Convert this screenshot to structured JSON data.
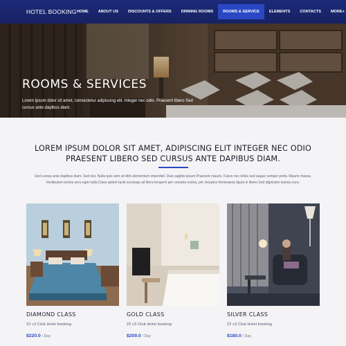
{
  "nav": {
    "brand": "HOTEL BOOKING",
    "items": [
      {
        "label": "HOME"
      },
      {
        "label": "ABOUT US"
      },
      {
        "label": "DISCOUNTS & OFFERS"
      },
      {
        "label": "DINNING ROOMS"
      },
      {
        "label": "ROOMS & SERVICE",
        "active": true
      },
      {
        "label": "ELEMENTS"
      },
      {
        "label": "CONTACTS"
      },
      {
        "label": "MORE+"
      }
    ]
  },
  "hero": {
    "title": "ROOMS & SERVICES",
    "subtitle": "Lorem ipsum dolor sit amet, consectetur adipiscing elit. Integer nec odio. Praesent libero Sed cursus ante dapibus diam."
  },
  "intro": {
    "title": "LOREM IPSUM DOLOR SIT AMET, ADIPISCING ELIT INTEGER NEC ODIO PRAESENT LIBERO SED CURSUS ANTE DAPIBUS DIAM.",
    "text": "Sed cursus ante dapibus diam. Sed nisi. Nulla quis sem at nibh elementum imperdiet. Duis sagittis ipsum.Praesent mauris. Fusce nec tellus sed augue semper porta. Mauris massa. Vestibulum lacinia arcu eget nulla.Class aptent taciti sociosqu ad litora torquent per conubia nostra, per inceptos himenaeos ligula in libero.Sed dignissim lacinia nunc."
  },
  "rooms": [
    {
      "name": "DIAMOND CLASS",
      "subtitle": "22 c3 Club Hotel booking",
      "price": "$220.0",
      "per": "/ Day"
    },
    {
      "name": "GOLD CLASS",
      "subtitle": "22 c3 Club Hotel booking",
      "price": "$200.0",
      "per": "/ Day"
    },
    {
      "name": "SILVER CLASS",
      "subtitle": "22 c3 Club Hotel booking",
      "price": "$180.0",
      "per": "/ Day"
    }
  ],
  "colors": {
    "nav_bg": "#1c2a78",
    "accent": "#2a48c4",
    "page_bg": "#f4f4f6"
  }
}
